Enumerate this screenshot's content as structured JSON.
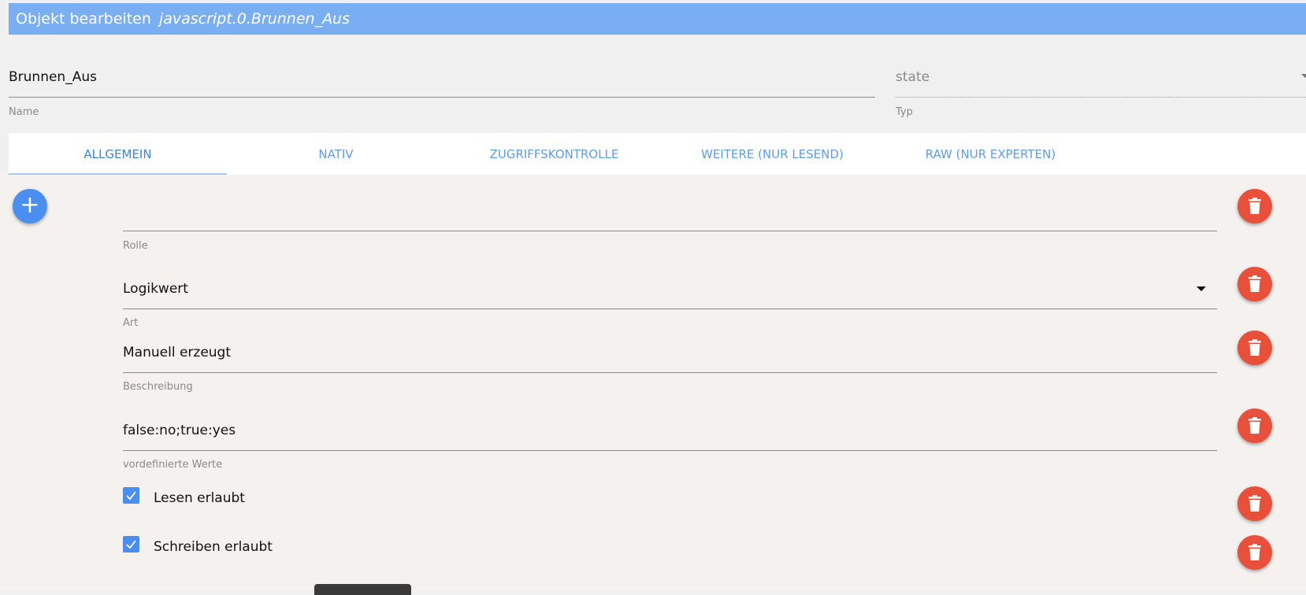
{
  "header": {
    "title": "Objekt bearbeiten",
    "object_id": "javascript.0.Brunnen_Aus"
  },
  "name_field": {
    "value": "Brunnen_Aus",
    "caption": "Name"
  },
  "type_field": {
    "value": "state",
    "caption": "Typ"
  },
  "tabs": [
    {
      "label": "ALLGEMEIN",
      "active": true
    },
    {
      "label": "NATIV",
      "active": false
    },
    {
      "label": "ZUGRIFFSKONTROLLE",
      "active": false
    },
    {
      "label": "WEITERE (NUR LESEND)",
      "active": false
    },
    {
      "label": "RAW (NUR EXPERTEN)",
      "active": false
    }
  ],
  "fields": {
    "rolle": {
      "value": "",
      "caption": "Rolle"
    },
    "art": {
      "value": "Logikwert",
      "caption": "Art"
    },
    "beschreibung": {
      "value": "Manuell erzeugt",
      "caption": "Beschreibung"
    },
    "werte": {
      "value": "false:no;true:yes",
      "caption": "vordefinierte Werte"
    }
  },
  "checkboxes": [
    {
      "label": "Lesen erlaubt",
      "checked": true
    },
    {
      "label": "Schreiben erlaubt",
      "checked": true
    }
  ],
  "icons": {
    "add": "plus-icon",
    "delete": "trash-icon",
    "check": "check-icon",
    "dropdown": "caret-down-icon"
  },
  "colors": {
    "titlebar": "#7aaef3",
    "accent": "#4a8ff0",
    "delete": "#e8503b",
    "tab_text": "#5d9cec"
  }
}
